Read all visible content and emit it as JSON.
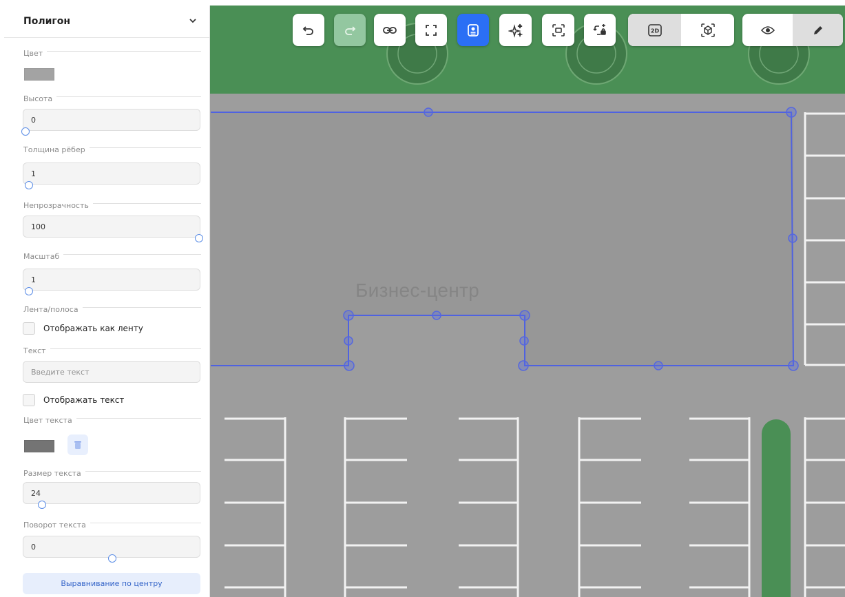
{
  "map": {
    "building_label": "Бизнес-центр"
  },
  "toolbar": {
    "buttons": [
      {
        "name": "undo",
        "icon": "undo-icon"
      },
      {
        "name": "redo",
        "icon": "redo-icon",
        "state": "disabled"
      },
      {
        "name": "link",
        "icon": "link-icon"
      },
      {
        "name": "fullscreen",
        "icon": "fullscreen-icon"
      },
      {
        "name": "card",
        "icon": "card-icon",
        "state": "active"
      },
      {
        "name": "magic",
        "icon": "sparkles-icon"
      },
      {
        "name": "fit",
        "icon": "fit-frame-icon"
      },
      {
        "name": "rotate-lock",
        "icon": "rotate-lock-icon"
      }
    ],
    "view_modes": [
      {
        "name": "2d",
        "label": "2D",
        "selected": true
      },
      {
        "name": "3d",
        "icon": "cube-icon",
        "selected": false
      }
    ],
    "edit_modes": [
      {
        "name": "view",
        "icon": "eye-icon",
        "selected": false
      },
      {
        "name": "edit",
        "icon": "pencil-icon",
        "selected": true
      }
    ],
    "colors": {
      "active": "#2b6ff5",
      "disabled": "#93c7a0",
      "selected_segment": "#dedede"
    }
  },
  "panel": {
    "title": "Полигон",
    "sections": {
      "color": "Цвет",
      "height": "Высота",
      "edge_thickness": "Толщина рёбер",
      "opacity": "Непрозрачность",
      "scale": "Масштаб",
      "ribbon": "Лента/полоса",
      "text": "Текст",
      "text_color": "Цвет текста",
      "text_size": "Размер текста",
      "text_rotation": "Поворот текста"
    },
    "fields": {
      "height": "0",
      "edge_thickness": "1",
      "opacity": "100",
      "scale": "1",
      "text_placeholder": "Введите текст",
      "text_size": "24",
      "text_rotation": "0"
    },
    "checkboxes": {
      "ribbon": "Отображать как ленту",
      "show_text": "Отображать текст"
    },
    "colors": {
      "polygon": "#a3a3a3",
      "text": "#747474"
    },
    "align_button": "Выравнивание по центру"
  }
}
